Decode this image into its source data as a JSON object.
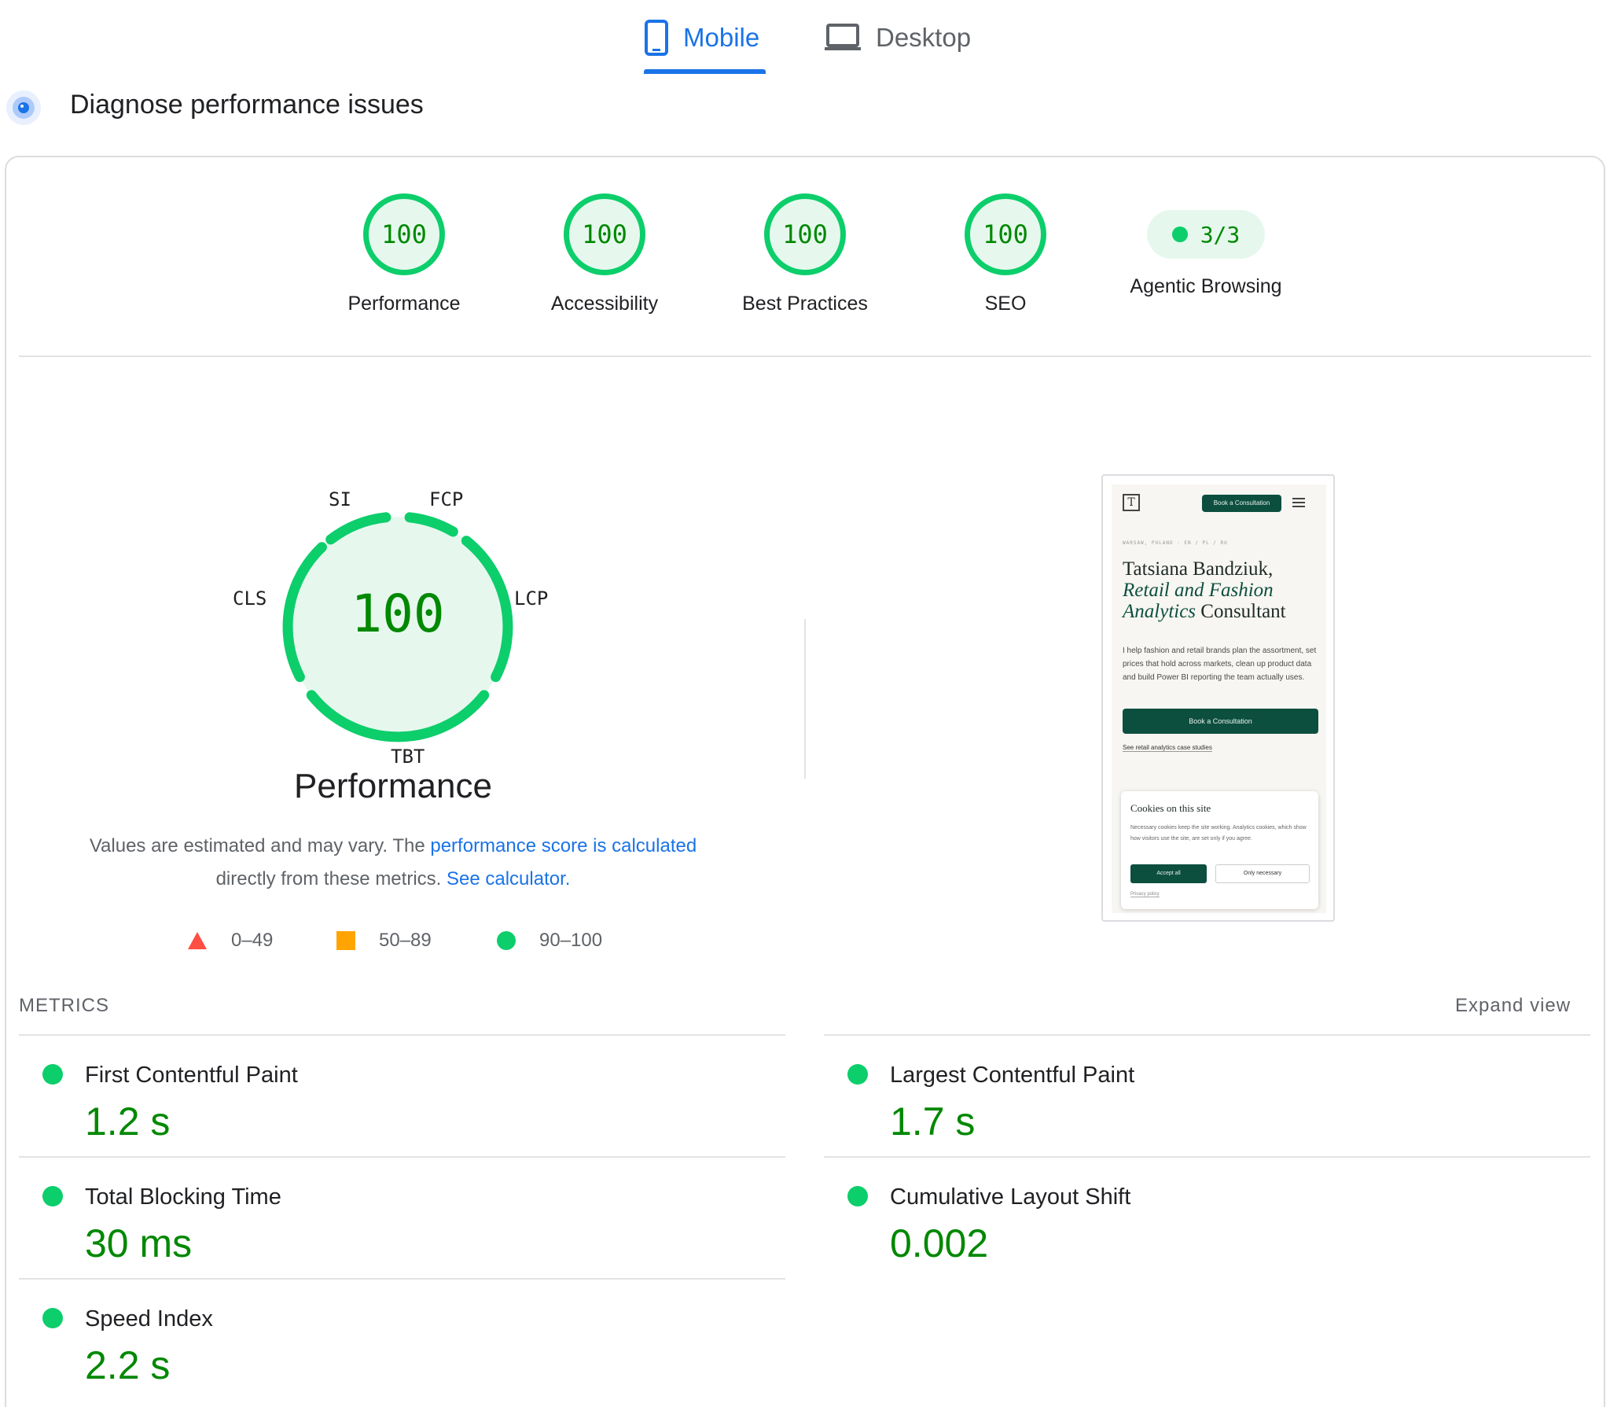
{
  "tabs": [
    {
      "label": "Mobile",
      "active": true
    },
    {
      "label": "Desktop",
      "active": false
    }
  ],
  "header": {
    "title": "Diagnose performance issues"
  },
  "categories": [
    {
      "label": "Performance",
      "score": "100"
    },
    {
      "label": "Accessibility",
      "score": "100"
    },
    {
      "label": "Best Practices",
      "score": "100"
    },
    {
      "label": "SEO",
      "score": "100"
    }
  ],
  "agentic": {
    "label": "Agentic Browsing",
    "value": "3/3"
  },
  "gauge": {
    "score": "100",
    "title": "Performance",
    "labels": {
      "si": "SI",
      "fcp": "FCP",
      "lcp": "LCP",
      "tbt": "TBT",
      "cls": "CLS"
    }
  },
  "note": {
    "prefix": "Values are estimated and may vary. The ",
    "link1": "performance score is calculated",
    "middle": "directly from these metrics. ",
    "link2": "See calculator."
  },
  "legend": [
    {
      "range": "0–49",
      "shape": "triangle",
      "color": "#ff4e42"
    },
    {
      "range": "50–89",
      "shape": "square",
      "color": "#ffa400"
    },
    {
      "range": "90–100",
      "shape": "circle",
      "color": "#0cce6b"
    }
  ],
  "screenshot": {
    "cta_small": "Book a Consultation",
    "eyebrow": "WARSAW, POLAND · EN / PL / RU",
    "heading_plain1": "Tatsiana Bandziuk,",
    "heading_italic1": "Retail and Fashion",
    "heading_italic2": "Analytics",
    "heading_plain2": " Consultant",
    "body": "I help fashion and retail brands plan the assortment, set prices that hold across markets, clean up product data and build Power BI reporting the team actually uses.",
    "cta_big": "Book a Consultation",
    "case_link": "See retail analytics case studies",
    "cookie_title": "Cookies on this site",
    "cookie_text": "Necessary cookies keep the site working. Analytics cookies, which show how visitors use the site, are set only if you agree.",
    "accept": "Accept all",
    "only": "Only necessary",
    "privacy": "Privacy policy"
  },
  "metrics": {
    "heading": "METRICS",
    "expand": "Expand view",
    "items": [
      {
        "name": "First Contentful Paint",
        "value": "1.2 s"
      },
      {
        "name": "Largest Contentful Paint",
        "value": "1.7 s"
      },
      {
        "name": "Total Blocking Time",
        "value": "30 ms"
      },
      {
        "name": "Cumulative Layout Shift",
        "value": "0.002"
      },
      {
        "name": "Speed Index",
        "value": "2.2 s"
      }
    ]
  },
  "colors": {
    "pass": "#0cce6b",
    "pass_text": "#008800",
    "accent": "#1a73e8"
  }
}
